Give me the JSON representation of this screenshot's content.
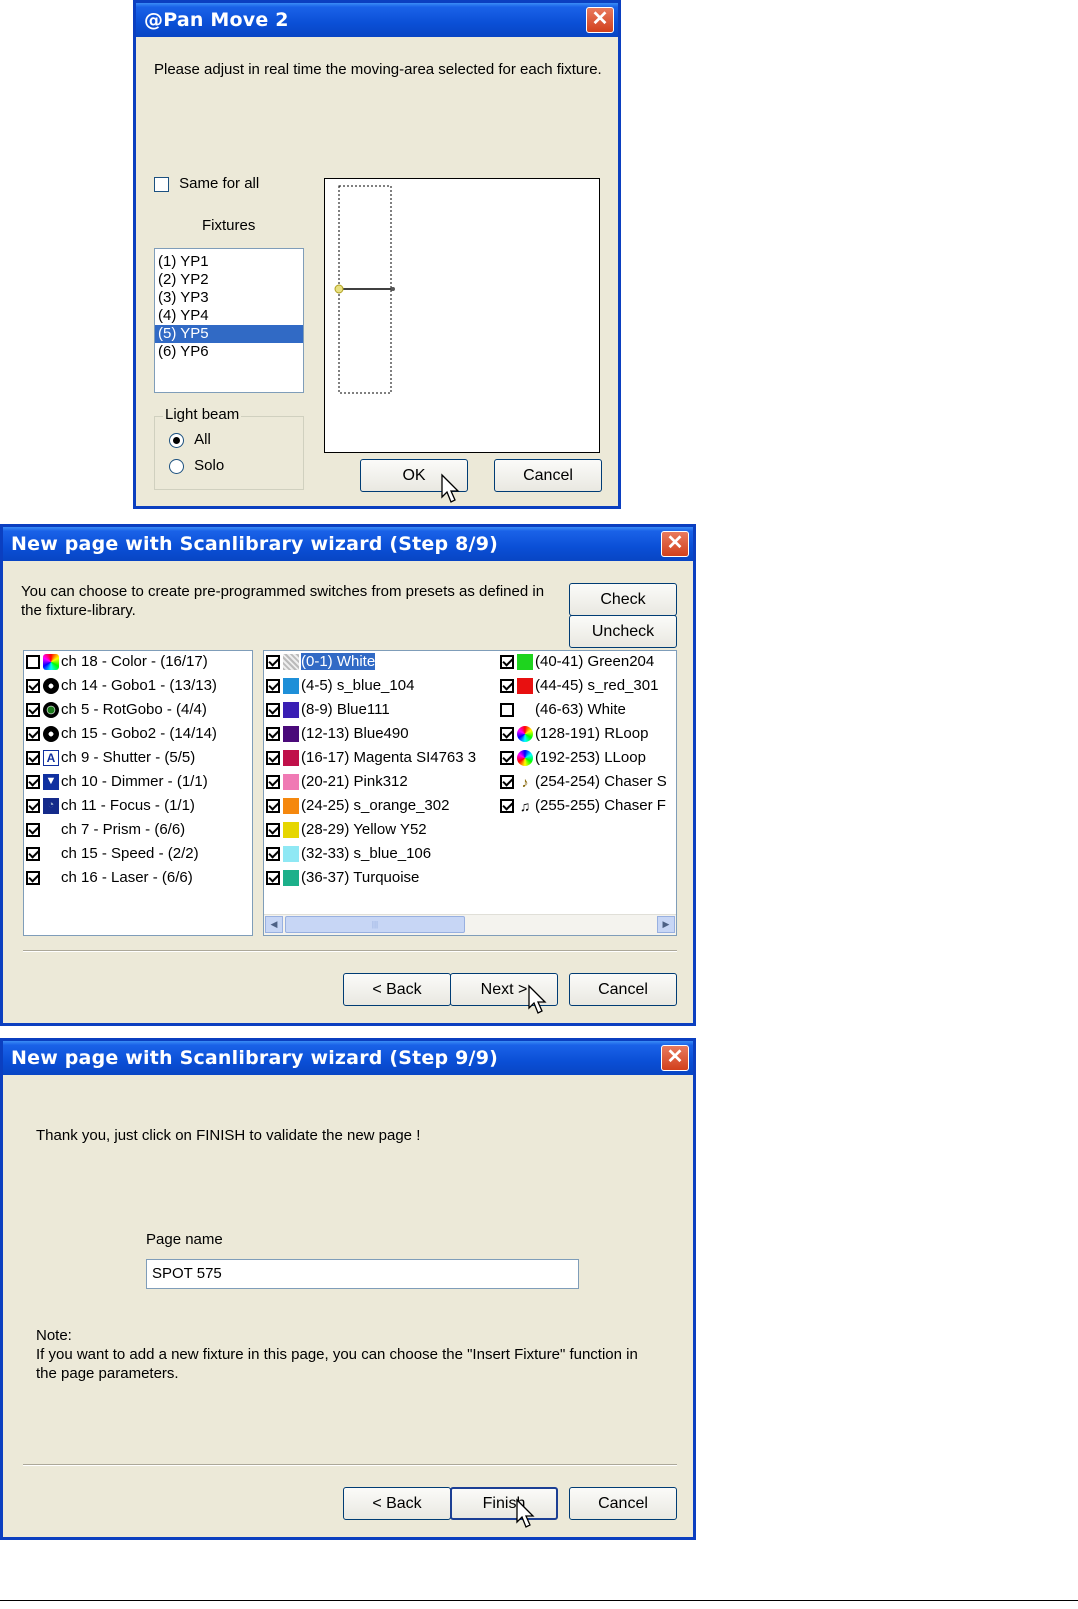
{
  "pan_move": {
    "title": "@Pan Move 2",
    "instruction": "Please adjust in real time the moving-area selected for each fixture.",
    "same_for_all": "Same for all",
    "fixtures_label": "Fixtures",
    "fixtures": [
      "(1) YP1",
      "(2) YP2",
      "(3) YP3",
      "(4) YP4",
      "(5) YP5",
      "(6) YP6"
    ],
    "selected_fixture": "(5) YP5",
    "light_beam_label": "Light beam",
    "light_beam_options": [
      "All",
      "Solo"
    ],
    "light_beam_selected": "All",
    "ok": "OK",
    "cancel": "Cancel"
  },
  "wizard8": {
    "title": "New page with Scanlibrary wizard (Step 8/9)",
    "instruction_line1": "You can choose to create pre-programmed switches from presets as defined in",
    "instruction_line2": "the fixture-library.",
    "check": "Check",
    "uncheck": "Uncheck",
    "channels": [
      {
        "label": "ch 18 - Color - (16/17)",
        "checked": false,
        "icon": "color-wheel-icon"
      },
      {
        "label": "ch 14 - Gobo1 - (13/13)",
        "checked": true,
        "icon": "gobo-icon"
      },
      {
        "label": "ch 5 - RotGobo - (4/4)",
        "checked": true,
        "icon": "rotgobo-icon"
      },
      {
        "label": "ch 15 - Gobo2 - (14/14)",
        "checked": true,
        "icon": "gobo-icon"
      },
      {
        "label": "ch 9 - Shutter - (5/5)",
        "checked": true,
        "icon": "shutter-icon"
      },
      {
        "label": "ch 10 - Dimmer - (1/1)",
        "checked": true,
        "icon": "dimmer-icon"
      },
      {
        "label": "ch 11 - Focus - (1/1)",
        "checked": true,
        "icon": "focus-icon"
      },
      {
        "label": "ch 7 - Prism - (6/6)",
        "checked": true,
        "icon": ""
      },
      {
        "label": "ch 15 - Speed - (2/2)",
        "checked": true,
        "icon": ""
      },
      {
        "label": "ch 16 - Laser - (6/6)",
        "checked": true,
        "icon": ""
      }
    ],
    "presets_col1": [
      {
        "label": "(0-1) White",
        "color": "#c8c8c8",
        "checked": true,
        "selected": true
      },
      {
        "label": "(4-5) s_blue_104",
        "color": "#1e8fd8",
        "checked": true
      },
      {
        "label": "(8-9) Blue111",
        "color": "#3a1fb4",
        "checked": true
      },
      {
        "label": "(12-13) Blue490",
        "color": "#4a0a7a",
        "checked": true
      },
      {
        "label": "(16-17) Magenta SI4763 3",
        "color": "#c0104a",
        "checked": true
      },
      {
        "label": "(20-21) Pink312",
        "color": "#f07ab4",
        "checked": true
      },
      {
        "label": "(24-25) s_orange_302",
        "color": "#f5880e",
        "checked": true
      },
      {
        "label": "(28-29) Yellow Y52",
        "color": "#e6d600",
        "checked": true
      },
      {
        "label": "(32-33) s_blue_106",
        "color": "#8fe8f4",
        "checked": true
      },
      {
        "label": "(36-37) Turquoise",
        "color": "#1cb08a",
        "checked": true
      }
    ],
    "presets_col2": [
      {
        "label": "(40-41) Green204",
        "color": "#1ed41e",
        "checked": true
      },
      {
        "label": "(44-45) s_red_301",
        "color": "#e81010",
        "checked": true
      },
      {
        "label": "(46-63) White",
        "color": "",
        "checked": false
      },
      {
        "label": "(128-191) RLoop",
        "color": "",
        "checked": true,
        "icon": "rloop-icon"
      },
      {
        "label": "(192-253) LLoop",
        "color": "",
        "checked": true,
        "icon": "lloop-icon"
      },
      {
        "label": "(254-254) Chaser S",
        "color": "",
        "checked": true,
        "icon": "chaser-s-icon"
      },
      {
        "label": "(255-255) Chaser F",
        "color": "",
        "checked": true,
        "icon": "chaser-f-icon"
      }
    ],
    "back": "< Back",
    "next": "Next >",
    "cancel": "Cancel"
  },
  "wizard9": {
    "title": "New page with Scanlibrary wizard (Step 9/9)",
    "thanks": "Thank you, just click on FINISH to validate the new page !",
    "page_name_label": "Page name",
    "page_name_value": "SPOT 575",
    "note_label": "Note:",
    "note_line1": "If you want to add a new fixture in this page, you can choose the \"Insert Fixture\" function in",
    "note_line2": "the page parameters.",
    "back": "< Back",
    "finish": "Finish",
    "cancel": "Cancel"
  }
}
